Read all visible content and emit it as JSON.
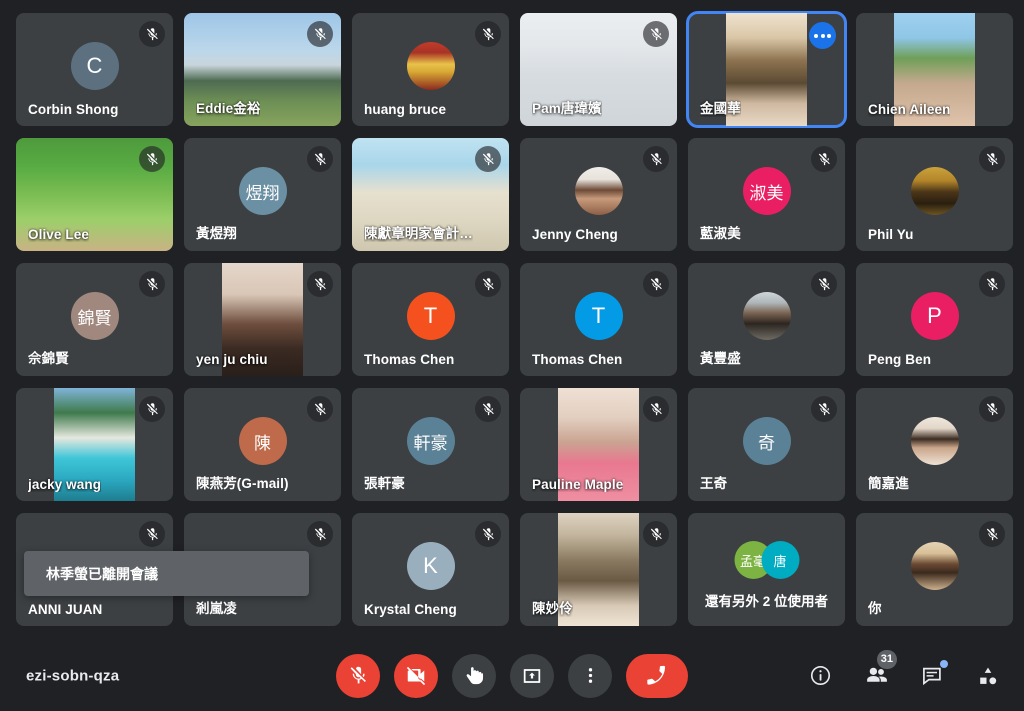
{
  "meeting": {
    "code": "ezi-sobn-qza",
    "participant_count": "31"
  },
  "toast": {
    "message": "林季螢已離開會議"
  },
  "tiles": [
    {
      "name": "Corbin Shong",
      "kind": "avatar-letter",
      "initial": "C",
      "avatar_color": "#5c7080",
      "muted": true,
      "active": false
    },
    {
      "name": "Eddie金裕",
      "kind": "video",
      "video": "v-mount",
      "fit": "full",
      "muted": true,
      "active": false
    },
    {
      "name": "huang bruce",
      "kind": "avatar-photo",
      "photo": "a-bruce",
      "muted": true,
      "active": false
    },
    {
      "name": "Pam唐瑋嬪",
      "kind": "video",
      "video": "v-confroom",
      "fit": "full",
      "muted": true,
      "active": false
    },
    {
      "name": "金國華",
      "kind": "video",
      "video": "v-books",
      "fit": "portrait",
      "muted": false,
      "active": true
    },
    {
      "name": "Chien Aileen",
      "kind": "video",
      "video": "v-hills",
      "fit": "portrait",
      "muted": false,
      "active": false
    },
    {
      "name": "Olive Lee",
      "kind": "video",
      "video": "v-anime",
      "fit": "full",
      "muted": true,
      "active": false
    },
    {
      "name": "黃煜翔",
      "kind": "avatar-letter",
      "initial": "煜翔",
      "avatar_color": "#6b8fa3",
      "muted": true,
      "active": false
    },
    {
      "name": "陳獻章明家會計…",
      "kind": "video",
      "video": "v-beach",
      "fit": "full",
      "muted": true,
      "active": false
    },
    {
      "name": "Jenny Cheng",
      "kind": "avatar-photo",
      "photo": "a-jenny",
      "muted": true,
      "active": false
    },
    {
      "name": "藍淑美",
      "kind": "avatar-letter",
      "initial": "淑美",
      "avatar_color": "#e91e63",
      "muted": true,
      "active": false
    },
    {
      "name": "Phil Yu",
      "kind": "avatar-photo",
      "photo": "a-phil",
      "muted": true,
      "active": false
    },
    {
      "name": "佘錦賢",
      "kind": "avatar-letter",
      "initial": "錦賢",
      "avatar_color": "#a1887f",
      "muted": true,
      "active": false
    },
    {
      "name": "yen ju chiu",
      "kind": "video",
      "video": "v-portrait",
      "fit": "portrait",
      "muted": true,
      "active": false
    },
    {
      "name": "Thomas Chen",
      "kind": "avatar-letter",
      "initial": "T",
      "avatar_color": "#f4511e",
      "muted": true,
      "active": false
    },
    {
      "name": "Thomas Chen",
      "kind": "avatar-letter",
      "initial": "T",
      "avatar_color": "#039be5",
      "muted": true,
      "active": false
    },
    {
      "name": "黃豐盛",
      "kind": "avatar-photo",
      "photo": "a-feng",
      "muted": true,
      "active": false
    },
    {
      "name": "Peng Ben",
      "kind": "avatar-letter",
      "initial": "P",
      "avatar_color": "#e91e63",
      "muted": true,
      "active": false
    },
    {
      "name": "jacky wang",
      "kind": "video",
      "video": "v-tropical",
      "fit": "portrait",
      "muted": true,
      "active": false
    },
    {
      "name": "陳燕芳(G-mail)",
      "kind": "avatar-letter",
      "initial": "陳",
      "avatar_color": "#bf6a4a",
      "muted": true,
      "active": false
    },
    {
      "name": "張軒豪",
      "kind": "avatar-letter",
      "initial": "軒豪",
      "avatar_color": "#5b8196",
      "muted": true,
      "active": false
    },
    {
      "name": "Pauline Maple",
      "kind": "video",
      "video": "v-kitchen",
      "fit": "portrait",
      "muted": true,
      "active": false
    },
    {
      "name": "王奇",
      "kind": "avatar-letter",
      "initial": "奇",
      "avatar_color": "#5b8196",
      "muted": true,
      "active": false
    },
    {
      "name": "簡嘉進",
      "kind": "avatar-photo",
      "photo": "a-jian",
      "muted": true,
      "active": false
    },
    {
      "name": "ANNI JUAN",
      "kind": "blank",
      "muted": true,
      "active": false
    },
    {
      "name": "剎嵐凌",
      "kind": "blank",
      "muted": true,
      "active": false
    },
    {
      "name": "Krystal Cheng",
      "kind": "avatar-letter",
      "initial": "K",
      "avatar_color": "#9aafbe",
      "muted": true,
      "active": false
    },
    {
      "name": "陳妙伶",
      "kind": "video",
      "video": "v-shelf",
      "fit": "portrait",
      "muted": true,
      "active": false
    },
    {
      "name": "還有另外 2 位使用者",
      "kind": "overflow",
      "muted": false,
      "active": false,
      "group": [
        {
          "initial": "孟毫",
          "avatar_color": "#7cb342"
        },
        {
          "initial": "唐",
          "avatar_color": "#00acc1"
        }
      ]
    },
    {
      "name": "你",
      "kind": "avatar-photo",
      "photo": "a-you",
      "muted": true,
      "active": false
    }
  ],
  "controls": {
    "center": [
      {
        "id": "microphone",
        "label": "關閉麥克風",
        "icon": "mic-off-icon",
        "style": "danger"
      },
      {
        "id": "camera",
        "label": "關閉攝影機",
        "icon": "video-off-icon",
        "style": "danger"
      },
      {
        "id": "raise-hand",
        "label": "舉手",
        "icon": "raise-hand-icon",
        "style": "neutral"
      },
      {
        "id": "present",
        "label": "立即分享螢幕畫面",
        "icon": "present-screen-icon",
        "style": "neutral"
      },
      {
        "id": "more",
        "label": "更多選項",
        "icon": "more-vert-icon",
        "style": "neutral"
      },
      {
        "id": "leave",
        "label": "離開通話",
        "icon": "end-call-icon",
        "style": "hangup"
      }
    ],
    "right": [
      {
        "id": "meeting-details",
        "label": "會議詳細資料",
        "icon": "info-icon"
      },
      {
        "id": "participants",
        "label": "顯示所有參與者",
        "icon": "people-icon",
        "badge": "31"
      },
      {
        "id": "chat",
        "label": "與所有人進行即時通訊",
        "icon": "chat-icon",
        "dot": true
      },
      {
        "id": "activities",
        "label": "活動",
        "icon": "activities-icon"
      }
    ]
  }
}
